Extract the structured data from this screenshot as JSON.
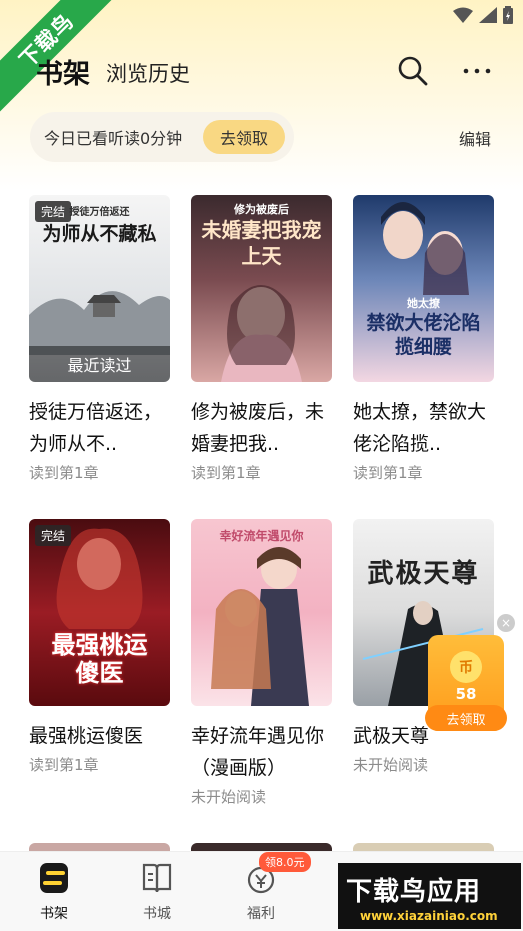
{
  "watermark": {
    "corner_text": "下载鸟",
    "app_text": "下载鸟应用",
    "site_text": "www.xiazainiao.com"
  },
  "header": {
    "tab_shelf": "书架",
    "tab_history": "浏览历史"
  },
  "reading": {
    "text": "今日已看听读0分钟",
    "claim_label": "去领取"
  },
  "edit_label": "编辑",
  "books": [
    {
      "title": "授徒万倍返还，为师从不..",
      "progress": "读到第1章",
      "badge": "完结",
      "overlay": "最近读过",
      "cover_text": "为师从不藏私",
      "cover_sub": "授徒万倍返还",
      "cover_bg": "#e6e8ea",
      "cover_fg": "#1a1a1a"
    },
    {
      "title": "修为被废后，未婚妻把我..",
      "progress": "读到第1章",
      "badge": "",
      "overlay": "",
      "cover_text": "未婚妻把我宠上天",
      "cover_sub": "修为被废后",
      "cover_bg": "#6b3b3f",
      "cover_fg": "#ffe6c8"
    },
    {
      "title": "她太撩，禁欲大佬沦陷揽..",
      "progress": "读到第1章",
      "badge": "",
      "overlay": "",
      "cover_text": "禁欲大佬沦陷揽细腰",
      "cover_sub": "她太撩",
      "cover_bg": "#2f4f84",
      "cover_fg": "#1b2f66"
    },
    {
      "title": "最强桃运傻医",
      "progress": "读到第1章",
      "badge": "完结",
      "overlay": "",
      "cover_text": "最强桃运傻医",
      "cover_sub": "",
      "cover_bg": "#7a1418",
      "cover_fg": "#ffffff"
    },
    {
      "title": "幸好流年遇见你（漫画版）",
      "progress": "未开始阅读",
      "badge": "",
      "overlay": "",
      "cover_text": "幸好流年遇见你",
      "cover_sub": "",
      "cover_bg": "#f3b7c4",
      "cover_fg": "#c04a6a"
    },
    {
      "title": "武极天尊",
      "progress": "未开始阅读",
      "badge": "",
      "overlay": "",
      "cover_text": "武极天尊",
      "cover_sub": "",
      "cover_bg": "#e8e8e8",
      "cover_fg": "#222222"
    }
  ],
  "reward": {
    "amount": "58",
    "claim_label": "去领取",
    "close": "×",
    "coin_symbol": "币"
  },
  "bottom_nav": {
    "shelf": "书架",
    "store": "书城",
    "welfare": "福利",
    "welfare_badge": "领8.0元"
  },
  "colors": {
    "accent": "#f9d883",
    "orange": "#ff9a1a",
    "ribbon": "#28a84a"
  }
}
